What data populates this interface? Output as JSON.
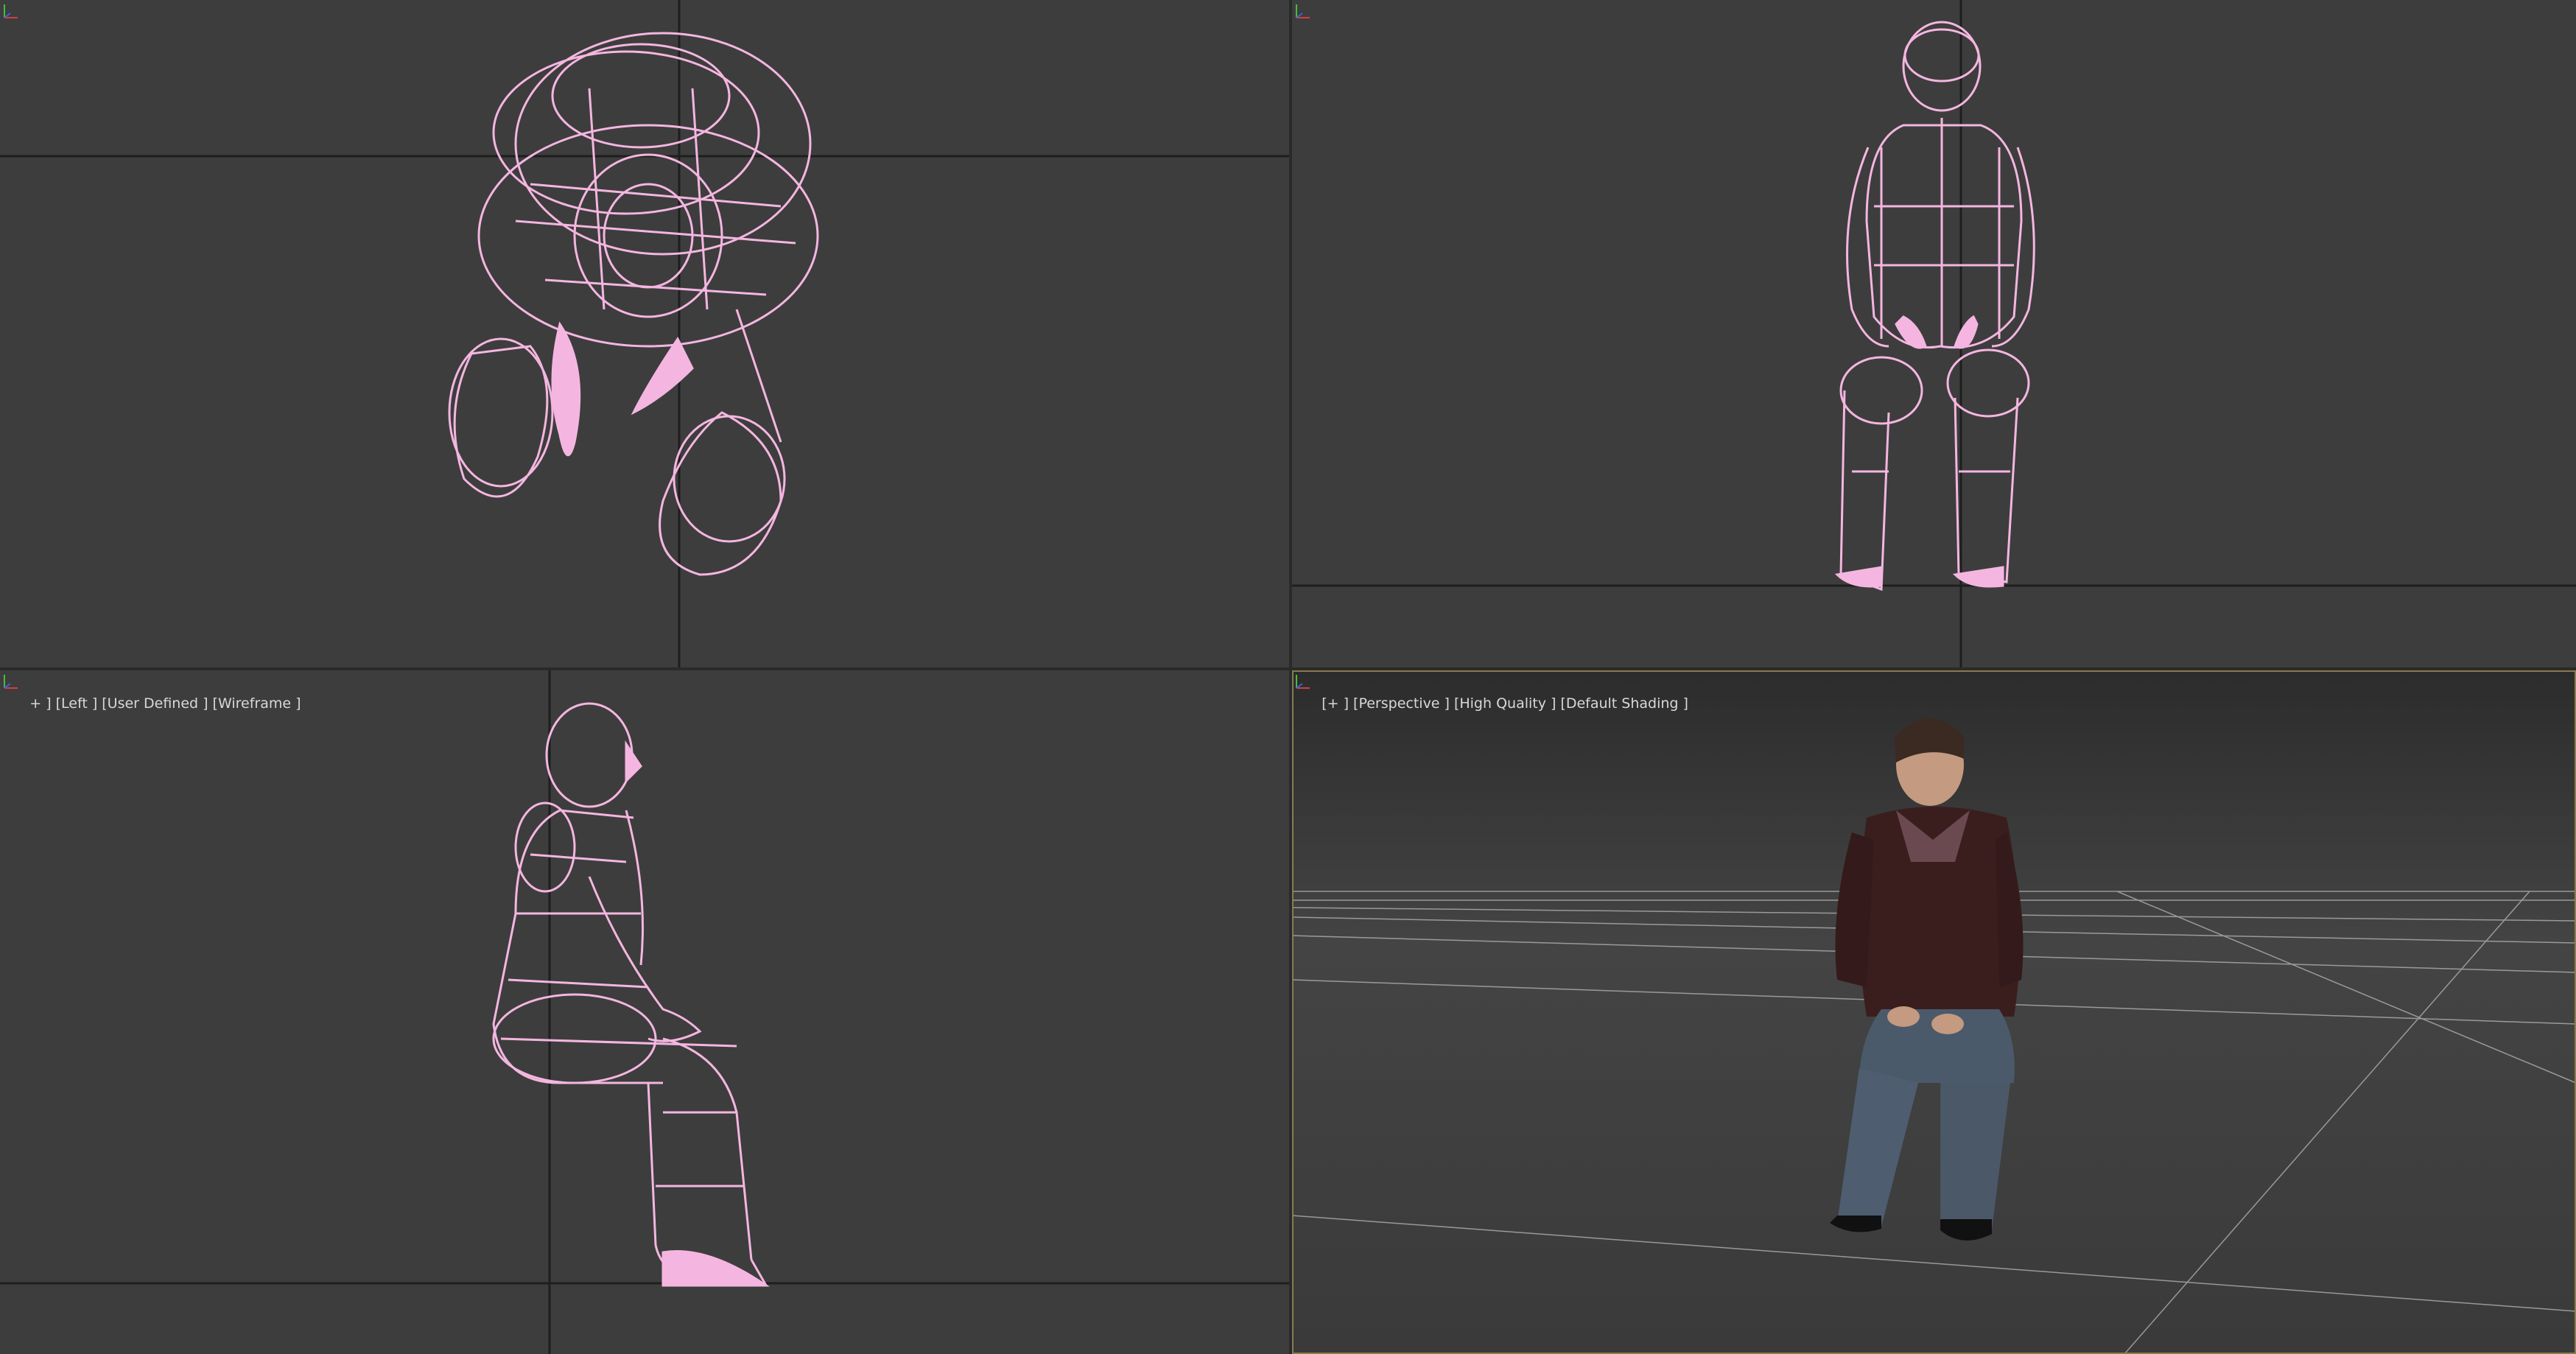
{
  "viewports": {
    "top": {
      "label": ""
    },
    "front": {
      "label": ""
    },
    "left": {
      "label_parts": [
        "+ ]",
        "[Left ]",
        "[User Defined ]",
        "[Wireframe ]"
      ]
    },
    "perspective": {
      "label_parts": [
        "[+ ]",
        "[Perspective ]",
        "[High Quality ]",
        "[Default Shading ]"
      ]
    }
  },
  "colors": {
    "viewport_bg": "#3d3d3d",
    "wireframe": "#f4b6e0",
    "grid_line": "#1e1e1e",
    "active_border": "#8a7a50"
  },
  "icons": {
    "axis_gizmo": "axis-tripod-icon"
  }
}
